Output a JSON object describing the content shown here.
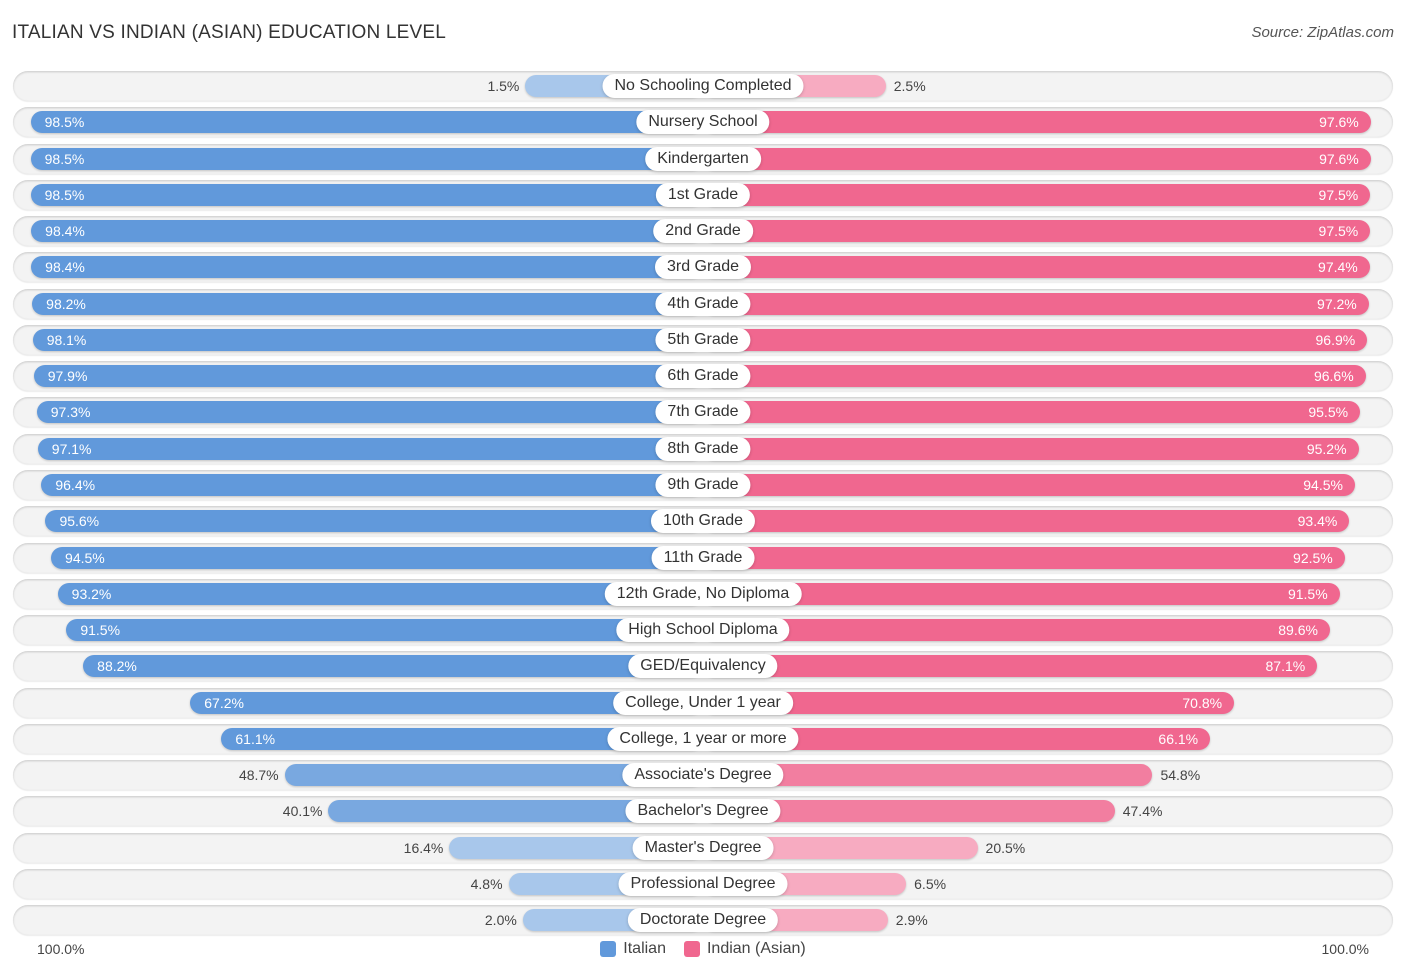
{
  "header": {
    "title": "ITALIAN VS INDIAN (ASIAN) EDUCATION LEVEL",
    "source": "Source: ZipAtlas.com"
  },
  "axis": {
    "left_label": "100.0%",
    "right_label": "100.0%"
  },
  "legend": [
    {
      "name": "Italian",
      "color": "#6199db"
    },
    {
      "name": "Indian (Asian)",
      "color": "#f0678f"
    }
  ],
  "chart_data": {
    "type": "bar",
    "orientation": "horizontal-diverging",
    "title": "ITALIAN VS INDIAN (ASIAN) EDUCATION LEVEL",
    "xlabel": "",
    "ylabel": "",
    "xlim": [
      0,
      100
    ],
    "legend_position": "bottom-center",
    "categories": [
      "No Schooling Completed",
      "Nursery School",
      "Kindergarten",
      "1st Grade",
      "2nd Grade",
      "3rd Grade",
      "4th Grade",
      "5th Grade",
      "6th Grade",
      "7th Grade",
      "8th Grade",
      "9th Grade",
      "10th Grade",
      "11th Grade",
      "12th Grade, No Diploma",
      "High School Diploma",
      "GED/Equivalency",
      "College, Under 1 year",
      "College, 1 year or more",
      "Associate's Degree",
      "Bachelor's Degree",
      "Master's Degree",
      "Professional Degree",
      "Doctorate Degree"
    ],
    "series": [
      {
        "name": "Italian",
        "values": [
          1.5,
          98.5,
          98.5,
          98.5,
          98.4,
          98.4,
          98.2,
          98.1,
          97.9,
          97.3,
          97.1,
          96.4,
          95.6,
          94.5,
          93.2,
          91.5,
          88.2,
          67.2,
          61.1,
          48.7,
          40.1,
          16.4,
          4.8,
          2.0
        ]
      },
      {
        "name": "Indian (Asian)",
        "values": [
          2.5,
          97.6,
          97.6,
          97.5,
          97.5,
          97.4,
          97.2,
          96.9,
          96.6,
          95.5,
          95.2,
          94.5,
          93.4,
          92.5,
          91.5,
          89.6,
          87.1,
          70.8,
          66.1,
          54.8,
          47.4,
          20.5,
          6.5,
          2.9
        ]
      }
    ],
    "value_labels_left": [
      "1.5%",
      "98.5%",
      "98.5%",
      "98.5%",
      "98.4%",
      "98.4%",
      "98.2%",
      "98.1%",
      "97.9%",
      "97.3%",
      "97.1%",
      "96.4%",
      "95.6%",
      "94.5%",
      "93.2%",
      "91.5%",
      "88.2%",
      "67.2%",
      "61.1%",
      "48.7%",
      "40.1%",
      "16.4%",
      "4.8%",
      "2.0%"
    ],
    "value_labels_right": [
      "2.5%",
      "97.6%",
      "97.6%",
      "97.5%",
      "97.5%",
      "97.4%",
      "97.2%",
      "96.9%",
      "96.6%",
      "95.5%",
      "95.2%",
      "94.5%",
      "93.4%",
      "92.5%",
      "91.5%",
      "89.6%",
      "87.1%",
      "70.8%",
      "66.1%",
      "54.8%",
      "47.4%",
      "20.5%",
      "6.5%",
      "2.9%"
    ]
  }
}
